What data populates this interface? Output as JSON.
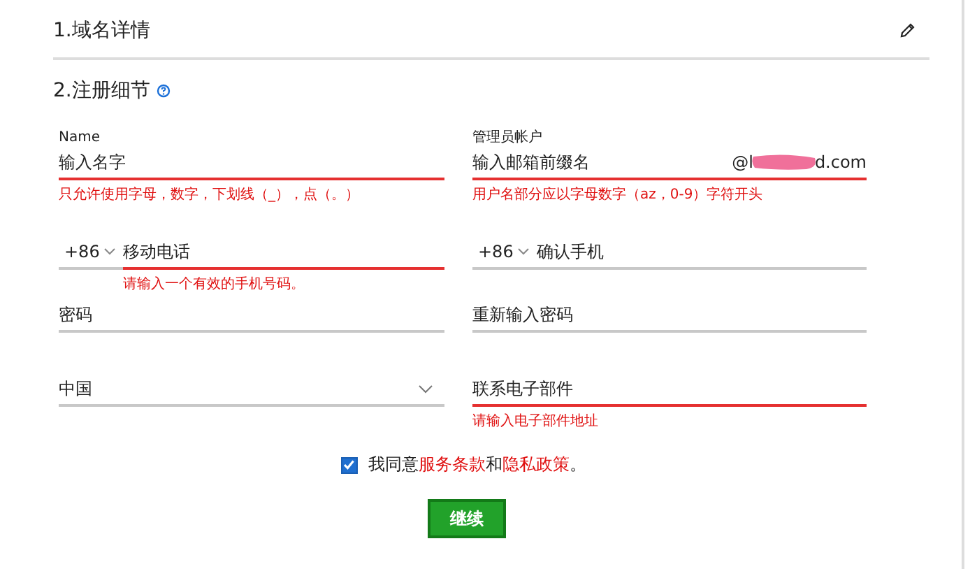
{
  "sections": [
    {
      "title": "1.域名详情",
      "kind": "collapsed"
    },
    {
      "title": "2.注册细节",
      "kind": "open"
    }
  ],
  "rows": [
    [
      {
        "kind": "text",
        "label": "Name",
        "placeholder": "输入名字",
        "invalid": true,
        "error": "只允许使用字母，数字，下划线（_），点（。）"
      },
      {
        "kind": "email",
        "label": "管理员帐户",
        "placeholder": "输入邮箱前缀名",
        "domain_start": "@l",
        "domain_end": "d.com",
        "invalid": true,
        "error": "用户名部分应以字母数字（az，0-9）字符开头"
      }
    ],
    [
      {
        "kind": "phone",
        "prefix": "+86",
        "placeholder": "移动电话",
        "invalid": true,
        "error": "请输入一个有效的手机号码。"
      },
      {
        "kind": "phone",
        "prefix": "+86",
        "placeholder": "确认手机",
        "invalid": false
      }
    ],
    [
      {
        "kind": "text",
        "placeholder": "密码",
        "invalid": false
      },
      {
        "kind": "text",
        "placeholder": "重新输入密码",
        "invalid": false
      }
    ],
    [
      {
        "kind": "select",
        "value": "中国",
        "invalid": false
      },
      {
        "kind": "text",
        "placeholder": "联系电子部件",
        "invalid": true,
        "error": "请输入电子部件地址"
      }
    ]
  ],
  "agreement": {
    "checked": true,
    "parts": [
      {
        "kind": "text",
        "text": "我同意"
      },
      {
        "kind": "link",
        "text": "服务条款"
      },
      {
        "kind": "text",
        "text": "和"
      },
      {
        "kind": "link",
        "text": "隐私政策"
      },
      {
        "kind": "text",
        "text": "。"
      }
    ]
  },
  "continue_button": "继续"
}
